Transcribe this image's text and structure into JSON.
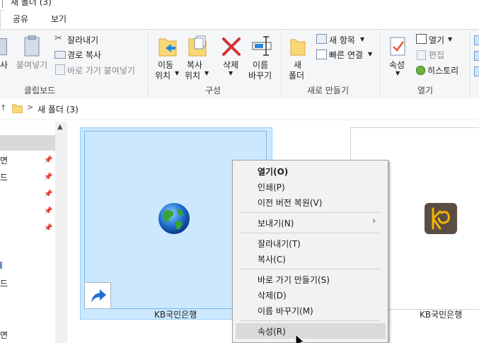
{
  "window": {
    "title": "새 폴더 (3)"
  },
  "tabs": [
    {
      "label": "공유"
    },
    {
      "label": "보기"
    }
  ],
  "ribbon": {
    "clipboard": {
      "partial_label": "사",
      "paste": "붙여넣기",
      "cut": "잘라내기",
      "copy_path": "경로 복사",
      "paste_shortcut": "바로 가기 붙여넣기",
      "group": "클립보드"
    },
    "organize": {
      "move_to_line1": "이동",
      "move_to_line2": "위치",
      "copy_to_line1": "복사",
      "copy_to_line2": "위치",
      "delete": "삭제",
      "rename_line1": "이름",
      "rename_line2": "바꾸기",
      "group": "구성"
    },
    "new": {
      "new_folder_line1": "새",
      "new_folder_line2": "폴더",
      "new_item": "새 항목",
      "easy_access": "빠른 연결",
      "group": "새로 만들기"
    },
    "open": {
      "properties": "속성",
      "open": "열기",
      "edit": "편집",
      "history": "히스토리",
      "group": "열기"
    }
  },
  "address": {
    "breadcrumb_sep": ">",
    "path": "새 폴더 (3)"
  },
  "nav_pane": {
    "items": [
      "면",
      "드",
      "",
      "",
      "",
      "",
      "",
      "드",
      "",
      "면"
    ]
  },
  "files": [
    {
      "name": "KB국민은행",
      "icon": "globe-shortcut-icon",
      "selected": true
    },
    {
      "name": "KB국민은행",
      "icon": "kb-app-icon",
      "selected": false
    }
  ],
  "context_menu": {
    "items": [
      {
        "label": "열기(O)",
        "bold": true
      },
      {
        "label": "인쇄(P)"
      },
      {
        "label": "이전 버전 복원(V)"
      },
      {
        "label": "보내기(N)",
        "submenu": true
      },
      {
        "label": "잘라내기(T)"
      },
      {
        "label": "복사(C)"
      },
      {
        "label": "바로 가기 만들기(S)"
      },
      {
        "label": "삭제(D)"
      },
      {
        "label": "이름 바꾸기(M)"
      },
      {
        "label": "속성(R)",
        "hover": true
      }
    ]
  },
  "colors": {
    "selection_bg": "#cce8ff",
    "selection_border": "#99d1ff",
    "ribbon_bg": "#f5f6f7",
    "delete_red": "#d13438",
    "folder_yellow": "#f8d775"
  }
}
